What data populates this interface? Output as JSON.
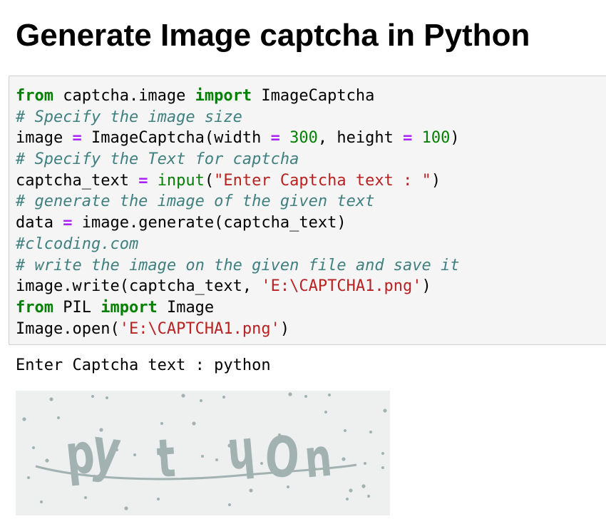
{
  "page": {
    "title": "Generate Image captcha in Python"
  },
  "code_cell": {
    "lines": [
      [
        {
          "t": "kw",
          "v": "from"
        },
        {
          "t": "text",
          "v": " captcha.image "
        },
        {
          "t": "kw",
          "v": "import"
        },
        {
          "t": "text",
          "v": " ImageCaptcha"
        }
      ],
      [
        {
          "t": "comment",
          "v": "# Specify the image size"
        }
      ],
      [
        {
          "t": "text",
          "v": "image "
        },
        {
          "t": "op",
          "v": "="
        },
        {
          "t": "text",
          "v": " ImageCaptcha(width "
        },
        {
          "t": "op",
          "v": "="
        },
        {
          "t": "text",
          "v": " "
        },
        {
          "t": "num",
          "v": "300"
        },
        {
          "t": "text",
          "v": ", height "
        },
        {
          "t": "op",
          "v": "="
        },
        {
          "t": "text",
          "v": " "
        },
        {
          "t": "num",
          "v": "100"
        },
        {
          "t": "text",
          "v": ")"
        }
      ],
      [
        {
          "t": "comment",
          "v": "# Specify the Text for captcha"
        }
      ],
      [
        {
          "t": "text",
          "v": "captcha_text "
        },
        {
          "t": "op",
          "v": "="
        },
        {
          "t": "text",
          "v": " "
        },
        {
          "t": "builtin",
          "v": "input"
        },
        {
          "t": "text",
          "v": "("
        },
        {
          "t": "str",
          "v": "\"Enter Captcha text : \""
        },
        {
          "t": "text",
          "v": ")"
        }
      ],
      [
        {
          "t": "comment",
          "v": "# generate the image of the given text"
        }
      ],
      [
        {
          "t": "text",
          "v": "data "
        },
        {
          "t": "op",
          "v": "="
        },
        {
          "t": "text",
          "v": " image.generate(captcha_text)"
        }
      ],
      [
        {
          "t": "comment",
          "v": "#clcoding.com"
        }
      ],
      [
        {
          "t": "comment",
          "v": "# write the image on the given file and save it"
        }
      ],
      [
        {
          "t": "text",
          "v": "image.write(captcha_text, "
        },
        {
          "t": "str",
          "v": "'E:\\CAPTCHA1.png'"
        },
        {
          "t": "text",
          "v": ")"
        }
      ],
      [
        {
          "t": "kw",
          "v": "from"
        },
        {
          "t": "text",
          "v": " PIL "
        },
        {
          "t": "kw",
          "v": "import"
        },
        {
          "t": "text",
          "v": " Image"
        }
      ],
      [
        {
          "t": "text",
          "v": "Image.open("
        },
        {
          "t": "str",
          "v": "'E:\\CAPTCHA1.png'"
        },
        {
          "t": "text",
          "v": ")"
        }
      ]
    ]
  },
  "output": {
    "stdout": "Enter Captcha text : python",
    "captcha_text": "python",
    "captcha_glyphs": [
      "p",
      "y",
      "t",
      "h",
      "O",
      "n"
    ]
  },
  "colors": {
    "keyword": "#008000",
    "operator": "#aa22ff",
    "string": "#ba2121",
    "comment": "#408080",
    "cell_background": "#f5f5f5",
    "captcha_background": "#eef0f0",
    "captcha_ink": "#a2b2b1"
  }
}
